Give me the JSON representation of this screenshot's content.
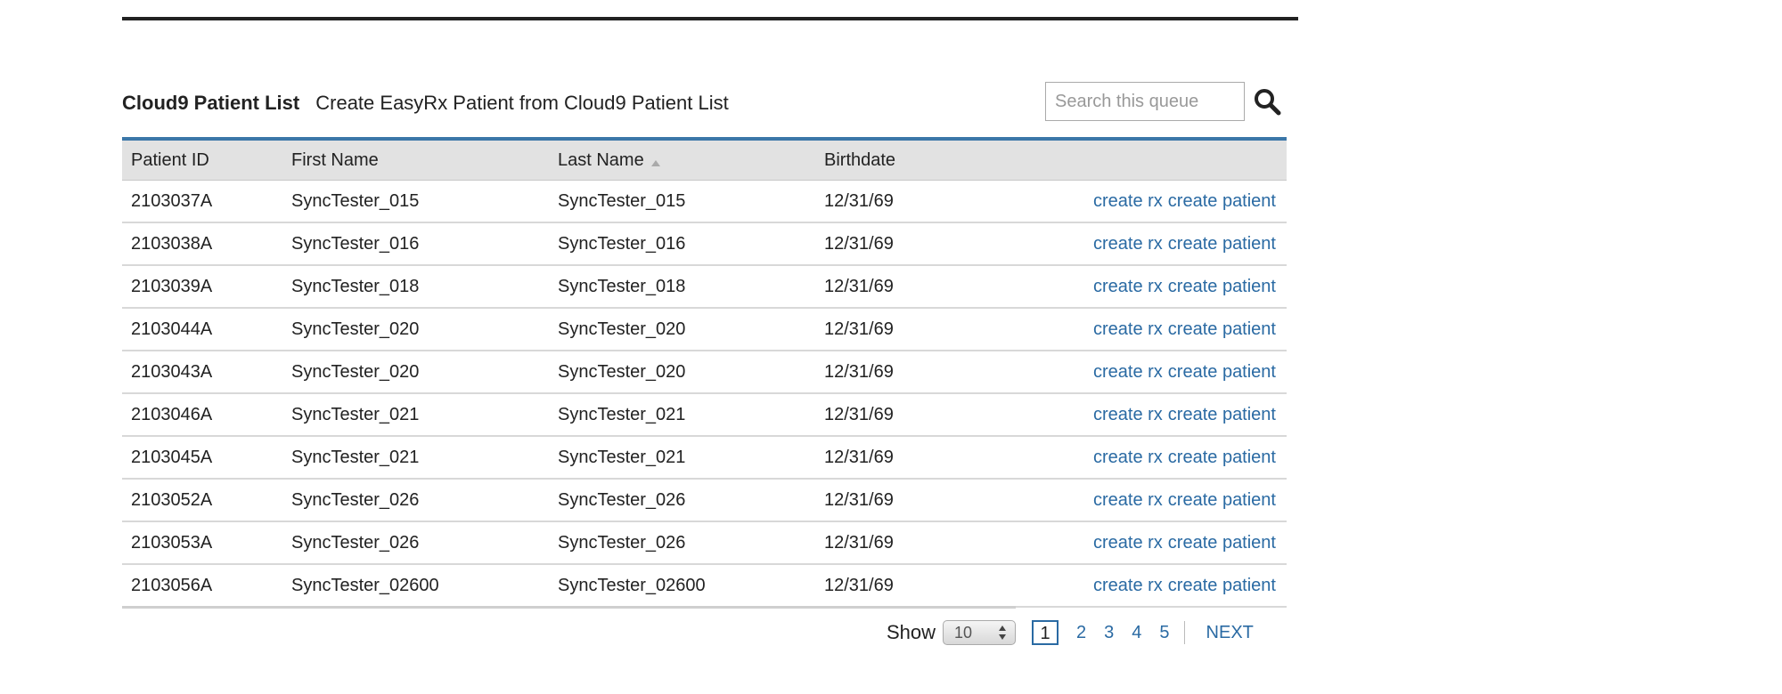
{
  "header": {
    "title": "Cloud9 Patient List",
    "subtitle": "Create EasyRx Patient from Cloud9 Patient List"
  },
  "search": {
    "placeholder": "Search this queue",
    "value": "",
    "icon": "search-icon"
  },
  "table": {
    "columns": {
      "patient_id": "Patient ID",
      "first_name": "First Name",
      "last_name": "Last Name",
      "birthdate": "Birthdate"
    },
    "sort": {
      "column": "last_name",
      "direction": "ascending"
    },
    "actions": {
      "create_rx": "create rx",
      "create_patient": "create patient"
    },
    "rows": [
      {
        "patient_id": "2103037A",
        "first_name": "SyncTester_015",
        "last_name": "SyncTester_015",
        "birthdate": "12/31/69"
      },
      {
        "patient_id": "2103038A",
        "first_name": "SyncTester_016",
        "last_name": "SyncTester_016",
        "birthdate": "12/31/69"
      },
      {
        "patient_id": "2103039A",
        "first_name": "SyncTester_018",
        "last_name": "SyncTester_018",
        "birthdate": "12/31/69"
      },
      {
        "patient_id": "2103044A",
        "first_name": "SyncTester_020",
        "last_name": "SyncTester_020",
        "birthdate": "12/31/69"
      },
      {
        "patient_id": "2103043A",
        "first_name": "SyncTester_020",
        "last_name": "SyncTester_020",
        "birthdate": "12/31/69"
      },
      {
        "patient_id": "2103046A",
        "first_name": "SyncTester_021",
        "last_name": "SyncTester_021",
        "birthdate": "12/31/69"
      },
      {
        "patient_id": "2103045A",
        "first_name": "SyncTester_021",
        "last_name": "SyncTester_021",
        "birthdate": "12/31/69"
      },
      {
        "patient_id": "2103052A",
        "first_name": "SyncTester_026",
        "last_name": "SyncTester_026",
        "birthdate": "12/31/69"
      },
      {
        "patient_id": "2103053A",
        "first_name": "SyncTester_026",
        "last_name": "SyncTester_026",
        "birthdate": "12/31/69"
      },
      {
        "patient_id": "2103056A",
        "first_name": "SyncTester_02600",
        "last_name": "SyncTester_02600",
        "birthdate": "12/31/69"
      }
    ]
  },
  "pagination": {
    "show_label": "Show",
    "page_size": "10",
    "pages": [
      "1",
      "2",
      "3",
      "4",
      "5"
    ],
    "current_page": "1",
    "next_label": "NEXT"
  },
  "colors": {
    "link": "#2a6aa3",
    "header_accent": "#3b77a8",
    "header_bg": "#e2e2e2",
    "rule": "#222222"
  }
}
